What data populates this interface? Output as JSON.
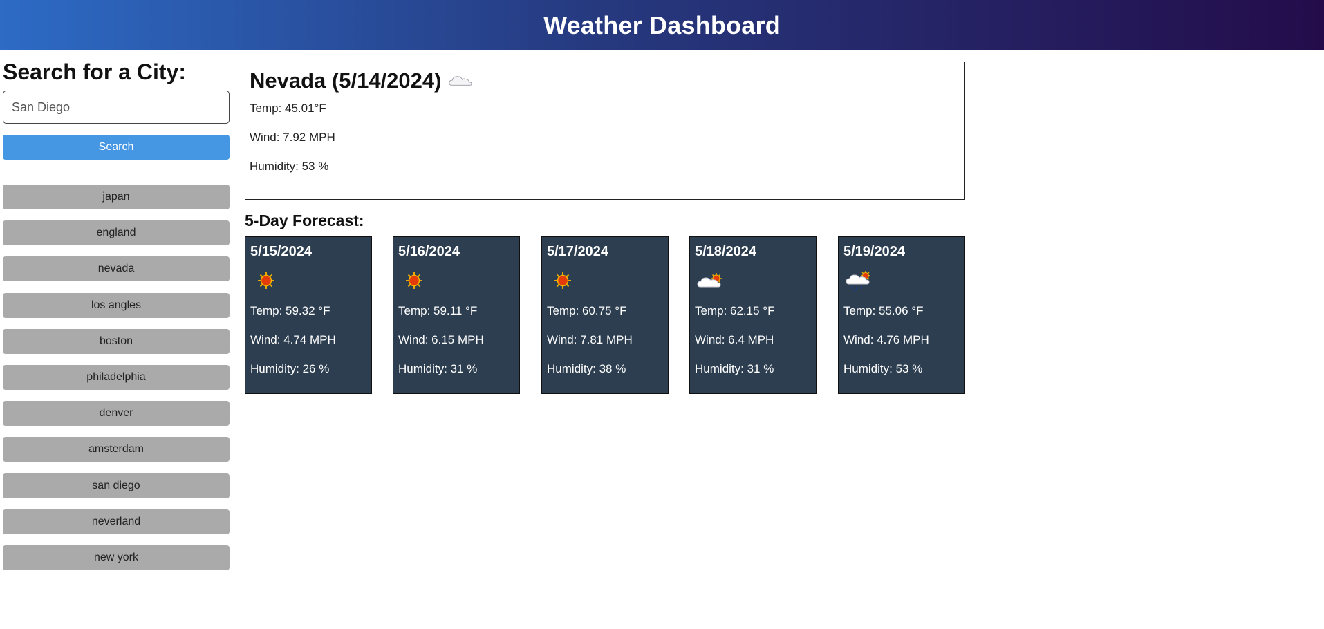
{
  "header": {
    "title": "Weather Dashboard"
  },
  "sidebar": {
    "heading": "Search for a City:",
    "input_value": "San Diego",
    "search_label": "Search",
    "history": [
      "japan",
      "england",
      "nevada",
      "los angles",
      "boston",
      "philadelphia",
      "denver",
      "amsterdam",
      "san diego",
      "neverland",
      "new york"
    ]
  },
  "current": {
    "title": "Nevada (5/14/2024)",
    "icon": "cloud-icon",
    "temp": "Temp: 45.01°F",
    "wind": "Wind: 7.92 MPH",
    "humidity": "Humidity: 53 %"
  },
  "forecast": {
    "heading": "5-Day Forecast:",
    "days": [
      {
        "date": "5/15/2024",
        "icon": "sun-icon",
        "temp": "Temp: 59.32 °F",
        "wind": "Wind: 4.74 MPH",
        "humidity": "Humidity: 26 %"
      },
      {
        "date": "5/16/2024",
        "icon": "sun-icon",
        "temp": "Temp: 59.11 °F",
        "wind": "Wind: 6.15 MPH",
        "humidity": "Humidity: 31 %"
      },
      {
        "date": "5/17/2024",
        "icon": "sun-icon",
        "temp": "Temp: 60.75 °F",
        "wind": "Wind: 7.81 MPH",
        "humidity": "Humidity: 38 %"
      },
      {
        "date": "5/18/2024",
        "icon": "partly-cloudy-icon",
        "temp": "Temp: 62.15 °F",
        "wind": "Wind: 6.4 MPH",
        "humidity": "Humidity: 31 %"
      },
      {
        "date": "5/19/2024",
        "icon": "rain-sun-icon",
        "temp": "Temp: 55.06 °F",
        "wind": "Wind: 4.76 MPH",
        "humidity": "Humidity: 53 %"
      }
    ]
  },
  "colors": {
    "header_gradient_start": "#2d6bc5",
    "header_gradient_end": "#240c4a",
    "search_button": "#4597e3",
    "history_button": "#aaaaaa",
    "forecast_card": "#2c3e50"
  }
}
